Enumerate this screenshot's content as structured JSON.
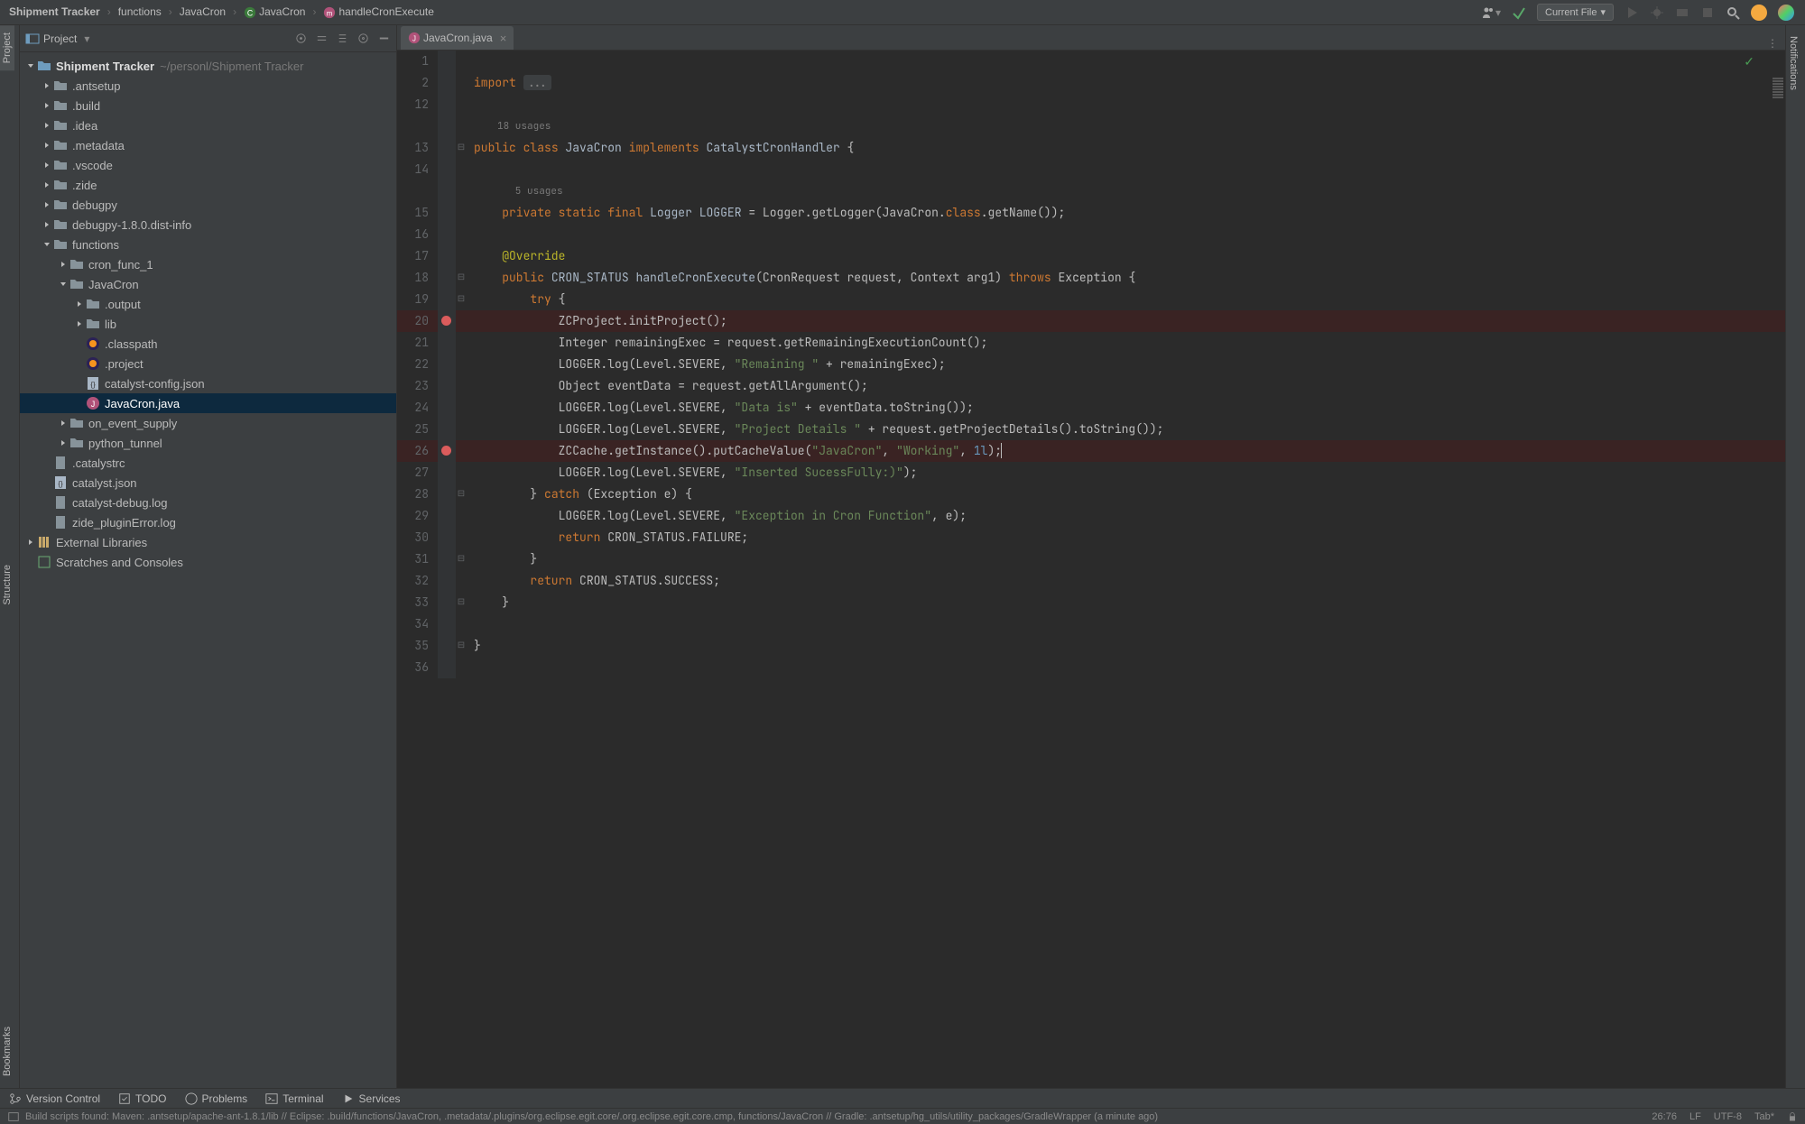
{
  "breadcrumbs": [
    "Shipment Tracker",
    "functions",
    "JavaCron",
    "JavaCron",
    "handleCronExecute"
  ],
  "topbar": {
    "run_config": "Current File"
  },
  "rails": {
    "left": {
      "project": "Project",
      "structure": "Structure",
      "bookmarks": "Bookmarks"
    },
    "right": {
      "notifications": "Notifications"
    }
  },
  "project_header": {
    "title": "Project"
  },
  "tree": {
    "root": {
      "label": "Shipment Tracker",
      "path": "~/personl/Shipment Tracker"
    },
    "nodes": [
      {
        "d": 1,
        "exp": false,
        "kind": "folder",
        "label": ".antsetup"
      },
      {
        "d": 1,
        "exp": false,
        "kind": "folder",
        "label": ".build"
      },
      {
        "d": 1,
        "exp": false,
        "kind": "folder",
        "label": ".idea"
      },
      {
        "d": 1,
        "exp": false,
        "kind": "folder",
        "label": ".metadata"
      },
      {
        "d": 1,
        "exp": false,
        "kind": "folder",
        "label": ".vscode"
      },
      {
        "d": 1,
        "exp": false,
        "kind": "folder",
        "label": ".zide"
      },
      {
        "d": 1,
        "exp": false,
        "kind": "folder",
        "label": "debugpy"
      },
      {
        "d": 1,
        "exp": false,
        "kind": "folder",
        "label": "debugpy-1.8.0.dist-info"
      },
      {
        "d": 1,
        "exp": true,
        "kind": "folder",
        "label": "functions"
      },
      {
        "d": 2,
        "exp": false,
        "kind": "folder",
        "label": "cron_func_1"
      },
      {
        "d": 2,
        "exp": true,
        "kind": "folder",
        "label": "JavaCron"
      },
      {
        "d": 3,
        "exp": false,
        "kind": "folder",
        "label": ".output"
      },
      {
        "d": 3,
        "exp": false,
        "kind": "folder",
        "label": "lib"
      },
      {
        "d": 3,
        "exp": null,
        "kind": "eclipse",
        "label": ".classpath"
      },
      {
        "d": 3,
        "exp": null,
        "kind": "eclipse",
        "label": ".project"
      },
      {
        "d": 3,
        "exp": null,
        "kind": "json",
        "label": "catalyst-config.json"
      },
      {
        "d": 3,
        "exp": null,
        "kind": "java",
        "label": "JavaCron.java",
        "sel": true
      },
      {
        "d": 2,
        "exp": false,
        "kind": "folder",
        "label": "on_event_supply"
      },
      {
        "d": 2,
        "exp": false,
        "kind": "folder",
        "label": "python_tunnel"
      },
      {
        "d": 1,
        "exp": null,
        "kind": "file",
        "label": ".catalystrc"
      },
      {
        "d": 1,
        "exp": null,
        "kind": "json",
        "label": "catalyst.json"
      },
      {
        "d": 1,
        "exp": null,
        "kind": "file",
        "label": "catalyst-debug.log"
      },
      {
        "d": 1,
        "exp": null,
        "kind": "file",
        "label": "zide_pluginError.log"
      }
    ],
    "ext": {
      "label": "External Libraries"
    },
    "scratch": {
      "label": "Scratches and Consoles"
    }
  },
  "tab": {
    "file": "JavaCron.java"
  },
  "code": {
    "usages_class": "18 usages",
    "usages_field": "5 usages",
    "class_name": "JavaCron",
    "iface": "CatalystCronHandler",
    "logger_line": "private static final Logger LOGGER = Logger.getLogger(JavaCron.class.getName());",
    "override": "@Override",
    "method_sig": "public CRON_STATUS handleCronExecute(CronRequest request, Context arg1) throws Exception {",
    "l20": "ZCProject.initProject();",
    "l21": "Integer remainingExec = request.getRemainingExecutionCount();",
    "l22_str": "\"Remaining \"",
    "l23": "Object eventData = request.getAllArgument();",
    "l24_str": "\"Data is\"",
    "l25_str": "\"Project Details \"",
    "l26_a": "\"JavaCron\"",
    "l26_b": "\"Working\"",
    "l26_c": "1l",
    "l27_str": "\"Inserted SucessFully:)\"",
    "l29_str": "\"Exception in Cron Function\""
  },
  "bottom": {
    "vc": "Version Control",
    "todo": "TODO",
    "problems": "Problems",
    "terminal": "Terminal",
    "services": "Services"
  },
  "status": {
    "msg": "Build scripts found: Maven: .antsetup/apache-ant-1.8.1/lib // Eclipse: .build/functions/JavaCron, .metadata/.plugins/org.eclipse.egit.core/.org.eclipse.egit.core.cmp, functions/JavaCron // Gradle: .antsetup/hg_utils/utility_packages/GradleWrapper (a minute ago)",
    "pos": "26:76",
    "lf": "LF",
    "enc": "UTF-8",
    "tab": "Tab*"
  }
}
